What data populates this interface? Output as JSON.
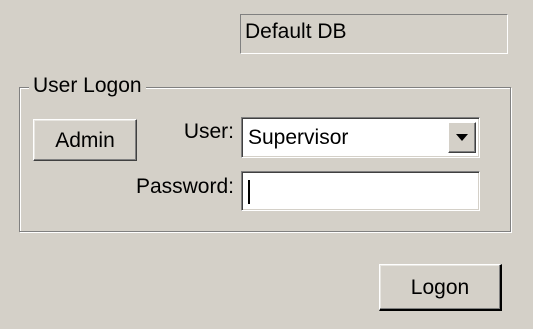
{
  "database": {
    "name": "Default DB"
  },
  "logon_group": {
    "legend": "User Logon",
    "admin_button_label": "Admin",
    "user_label": "User:",
    "user_selected": "Supervisor",
    "password_label": "Password:",
    "password_value": ""
  },
  "footer": {
    "logon_button_label": "Logon"
  },
  "icons": {
    "dropdown": "chevron-down-icon"
  }
}
